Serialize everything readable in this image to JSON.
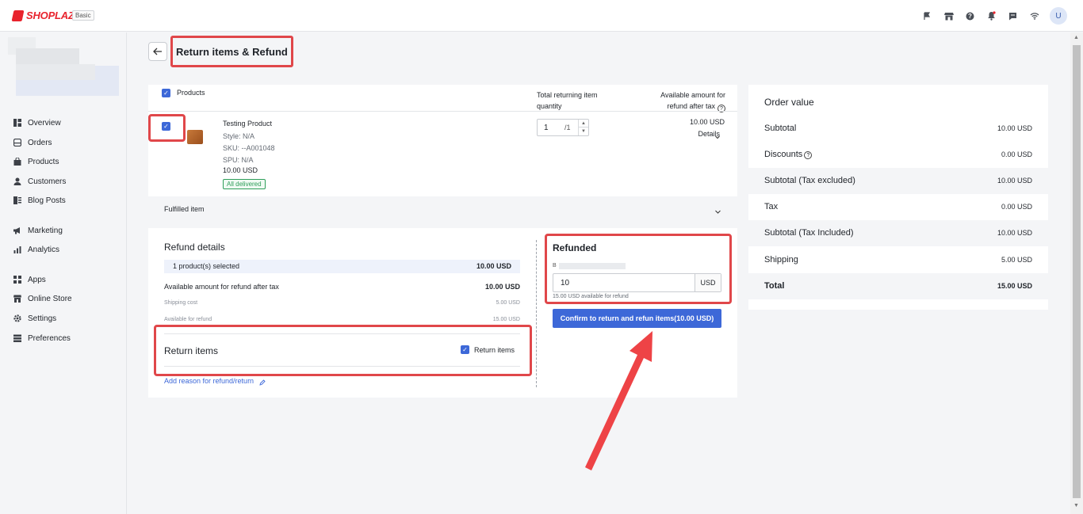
{
  "app": {
    "brand": "SHOPLAZZA",
    "plan": "Basic",
    "user_initial": "U",
    "top_icons": [
      "flag-icon",
      "store-icon",
      "help-icon",
      "bell-icon",
      "chat-icon",
      "wifi-icon"
    ]
  },
  "sidebar": {
    "items": [
      {
        "label": "Overview",
        "icon": "overview-icon"
      },
      {
        "label": "Orders",
        "icon": "orders-icon"
      },
      {
        "label": "Products",
        "icon": "products-icon"
      },
      {
        "label": "Customers",
        "icon": "customers-icon"
      },
      {
        "label": "Blog Posts",
        "icon": "blog-icon"
      },
      {
        "label": "Marketing",
        "icon": "marketing-icon"
      },
      {
        "label": "Analytics",
        "icon": "analytics-icon"
      },
      {
        "label": "Apps",
        "icon": "apps-icon"
      },
      {
        "label": "Online Store",
        "icon": "store-icon"
      },
      {
        "label": "Settings",
        "icon": "gear-icon"
      },
      {
        "label": "Preferences",
        "icon": "preferences-icon"
      }
    ]
  },
  "header": {
    "title": "Return items & Refund"
  },
  "products": {
    "header_label": "Products",
    "col_qty_line1": "Total returning item",
    "col_qty_line2": "quantity",
    "col_avail_line1": "Available amount for",
    "col_avail_line2": "refund after tax",
    "item": {
      "name": "Testing Product",
      "style": "Style: N/A",
      "sku": "SKU: --A001048",
      "spu": "SPU: N/A",
      "price": "10.00 USD",
      "status": "All delivered",
      "qty_value": "1",
      "qty_max": "/1",
      "available": "10.00 USD",
      "details_label": "Details"
    },
    "fulfilled_label": "Fulfilled item"
  },
  "refund_details": {
    "title": "Refund details",
    "selected_label": "1 product(s) selected",
    "selected_amount": "10.00 USD",
    "available_label": "Available amount for refund after tax",
    "available_amount": "10.00 USD",
    "shipping_label": "Shipping cost",
    "shipping_amount": "5.00 USD",
    "avail_refund_label": "Available for refund",
    "avail_refund_amount": "15.00 USD",
    "return_items_title": "Return items",
    "return_items_check_label": "Return items",
    "add_reason_link": "Add reason for refund/return"
  },
  "refunded": {
    "title": "Refunded",
    "method_prefix": "B",
    "amount_value": "10",
    "currency": "USD",
    "hint": "15.00 USD available for refund",
    "confirm_label": "Confirm to return and refun items(10.00 USD)"
  },
  "order_value": {
    "title": "Order value",
    "rows": [
      {
        "label": "Subtotal",
        "value": "10.00 USD"
      },
      {
        "label": "Discounts",
        "value": "0.00 USD"
      },
      {
        "label": "Subtotal (Tax excluded)",
        "value": "10.00 USD"
      },
      {
        "label": "Tax",
        "value": "0.00 USD"
      },
      {
        "label": "Subtotal (Tax Included)",
        "value": "10.00 USD"
      },
      {
        "label": "Shipping",
        "value": "5.00 USD"
      },
      {
        "label": "Total",
        "value": "15.00 USD"
      }
    ]
  },
  "colors": {
    "accent": "#3d68d8",
    "highlight": "#e0474a",
    "success": "#2f9e5a",
    "brand": "#e8232d"
  }
}
